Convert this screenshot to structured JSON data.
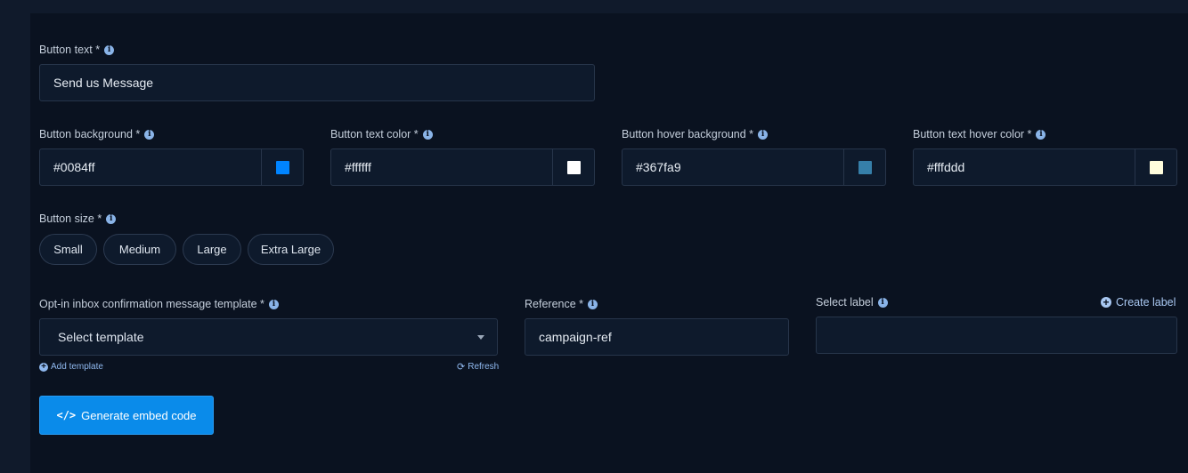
{
  "button_text": {
    "label": "Button text *",
    "value": "Send us Message"
  },
  "colors": [
    {
      "label": "Button background *",
      "value": "#0084ff",
      "swatch": "#0084ff"
    },
    {
      "label": "Button text color *",
      "value": "#ffffff",
      "swatch": "#ffffff"
    },
    {
      "label": "Button hover background *",
      "value": "#367fa9",
      "swatch": "#367fa9"
    },
    {
      "label": "Button text hover color *",
      "value": "#fffddd",
      "swatch": "#fffddd"
    }
  ],
  "button_size": {
    "label": "Button size *",
    "options": [
      "Small",
      "Medium",
      "Large",
      "Extra Large"
    ]
  },
  "template": {
    "label": "Opt-in inbox confirmation message template *",
    "placeholder": "Select template",
    "add_link": "Add template",
    "refresh_link": "Refresh"
  },
  "reference": {
    "label": "Reference *",
    "value": "campaign-ref"
  },
  "select_label": {
    "label": "Select label",
    "create_link": "Create label",
    "value": ""
  },
  "generate_button": {
    "label": "Generate embed code",
    "icon": "code-icon"
  },
  "icons": {
    "info": "info-icon",
    "plus": "plus-circle-icon",
    "refresh": "refresh-icon",
    "caret": "chevron-down-icon"
  },
  "theme": {
    "accent": "#0a8bea",
    "link": "#8fb8ee",
    "panel": "#0a1220",
    "field": "#0e1a2c"
  }
}
